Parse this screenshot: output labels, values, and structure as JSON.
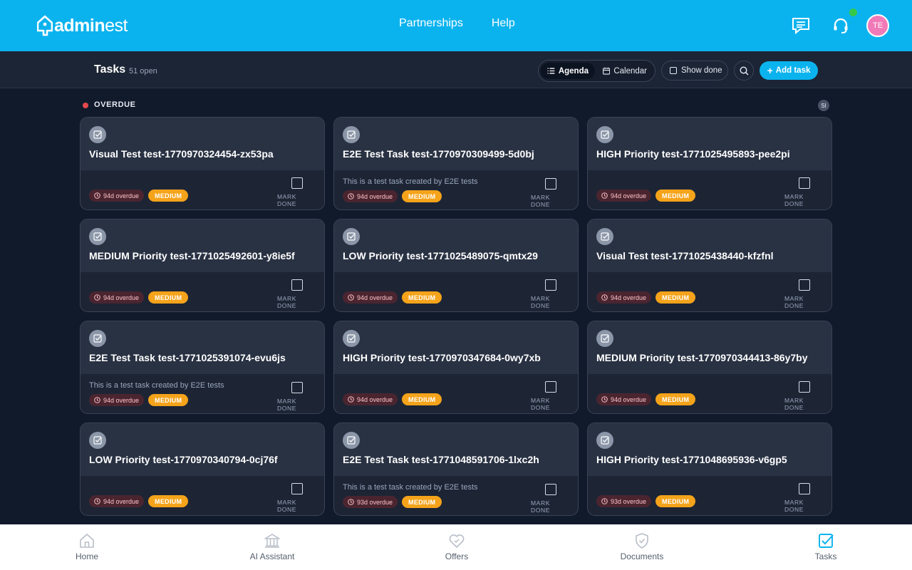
{
  "header": {
    "brand": {
      "bold": "admin",
      "light": "est"
    },
    "nav": [
      "Partnerships",
      "Help"
    ],
    "avatar_initials": "TE"
  },
  "toolbar": {
    "title": "Tasks",
    "count": "51 open",
    "views": [
      "Agenda",
      "Calendar"
    ],
    "active_view": "Agenda",
    "show_done": "Show done",
    "add_task": "Add task"
  },
  "section": {
    "label": "OVERDUE",
    "badge": "SI"
  },
  "mark_done_label": "MARK DONE",
  "tasks": [
    {
      "title": "Visual Test test-1770970324454-zx53pa",
      "description": "",
      "overdue": "94d overdue",
      "priority": "MEDIUM"
    },
    {
      "title": "E2E Test Task test-1770970309499-5d0bj",
      "description": "This is a test task created by E2E tests",
      "overdue": "94d overdue",
      "priority": "MEDIUM"
    },
    {
      "title": "HIGH Priority test-1771025495893-pee2pi",
      "description": "",
      "overdue": "94d overdue",
      "priority": "MEDIUM"
    },
    {
      "title": "MEDIUM Priority test-1771025492601-y8ie5f",
      "description": "",
      "overdue": "94d overdue",
      "priority": "MEDIUM"
    },
    {
      "title": "LOW Priority test-1771025489075-qmtx29",
      "description": "",
      "overdue": "94d overdue",
      "priority": "MEDIUM"
    },
    {
      "title": "Visual Test test-1771025438440-kfzfnl",
      "description": "",
      "overdue": "94d overdue",
      "priority": "MEDIUM"
    },
    {
      "title": "E2E Test Task test-1771025391074-evu6js",
      "description": "This is a test task created by E2E tests",
      "overdue": "94d overdue",
      "priority": "MEDIUM"
    },
    {
      "title": "HIGH Priority test-1770970347684-0wy7xb",
      "description": "",
      "overdue": "94d overdue",
      "priority": "MEDIUM"
    },
    {
      "title": "MEDIUM Priority test-1770970344413-86y7by",
      "description": "",
      "overdue": "94d overdue",
      "priority": "MEDIUM"
    },
    {
      "title": "LOW Priority test-1770970340794-0cj76f",
      "description": "",
      "overdue": "94d overdue",
      "priority": "MEDIUM"
    },
    {
      "title": "E2E Test Task test-1771048591706-1lxc2h",
      "description": "This is a test task created by E2E tests",
      "overdue": "93d overdue",
      "priority": "MEDIUM"
    },
    {
      "title": "HIGH Priority test-1771048695936-v6gp5",
      "description": "",
      "overdue": "93d overdue",
      "priority": "MEDIUM"
    }
  ],
  "bottom_nav": [
    {
      "label": "Home",
      "icon": "home-icon"
    },
    {
      "label": "AI Assistant",
      "icon": "bank-icon"
    },
    {
      "label": "Offers",
      "icon": "offers-icon"
    },
    {
      "label": "Documents",
      "icon": "shield-check-icon"
    },
    {
      "label": "Tasks",
      "icon": "tasks-icon"
    }
  ],
  "active_bottom_nav": "Tasks",
  "colors": {
    "header": "#0bb3ee",
    "background": "#111a2b",
    "overdue_dot": "#e5484d",
    "priority_medium": "#f5a31a",
    "avatar": "#f07ab7",
    "online": "#37c84b"
  }
}
